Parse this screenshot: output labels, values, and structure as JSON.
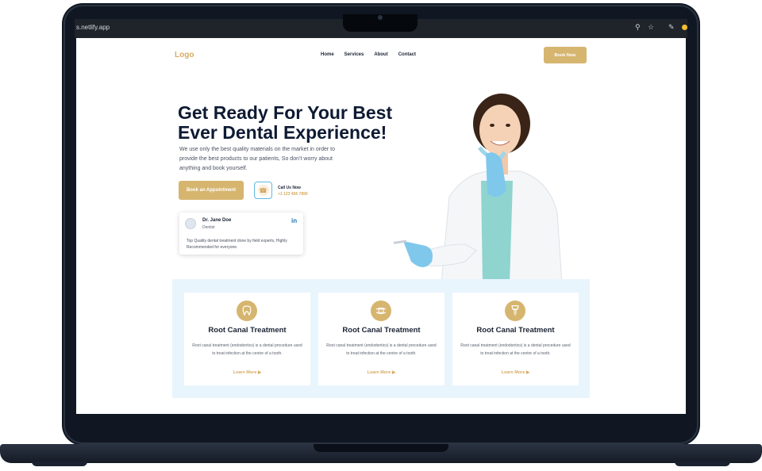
{
  "browser": {
    "url": "s.netlify.app",
    "icons": [
      "zoom-icon",
      "star-icon",
      "pen-icon",
      "extension-icon"
    ]
  },
  "header": {
    "logo": "Logo",
    "nav": [
      "Home",
      "Services",
      "About",
      "Contact"
    ],
    "book_now": "Book Now"
  },
  "hero": {
    "title": "Get Ready For Your Best Ever Dental Experience!",
    "description": "We use only the best quality materials on the market in order to provide the best products to our patients, So don’t worry about anything and book yourself.",
    "appointment_button": "Book an Appointment",
    "call_label": "Call Us Now",
    "call_number": "+1 123 456 7890"
  },
  "review": {
    "name": "Dr. Jane Doe",
    "role": "Dentist",
    "text": "Top Quality dental treatment done by field experts, Highly Recommended for everyone."
  },
  "services": [
    {
      "title": "Root Canal Treatment",
      "description": "Root canal treatment (endodontics) is a dental procedure used to treat infection at the centre of a tooth.",
      "link": "Learn More",
      "icon": "tooth-icon"
    },
    {
      "title": "Root Canal Treatment",
      "description": "Root canal treatment (endodontics) is a dental procedure used to treat infection at the centre of a tooth.",
      "link": "Learn More",
      "icon": "braces-icon"
    },
    {
      "title": "Root Canal Treatment",
      "description": "Root canal treatment (endodontics) is a dental procedure used to treat infection at the centre of a tooth.",
      "link": "Learn More",
      "icon": "implant-icon"
    }
  ],
  "colors": {
    "accent": "#d6b56f",
    "dark_text": "#0e1a33",
    "services_bg": "#e9f5fd",
    "laptop": "#101722"
  }
}
